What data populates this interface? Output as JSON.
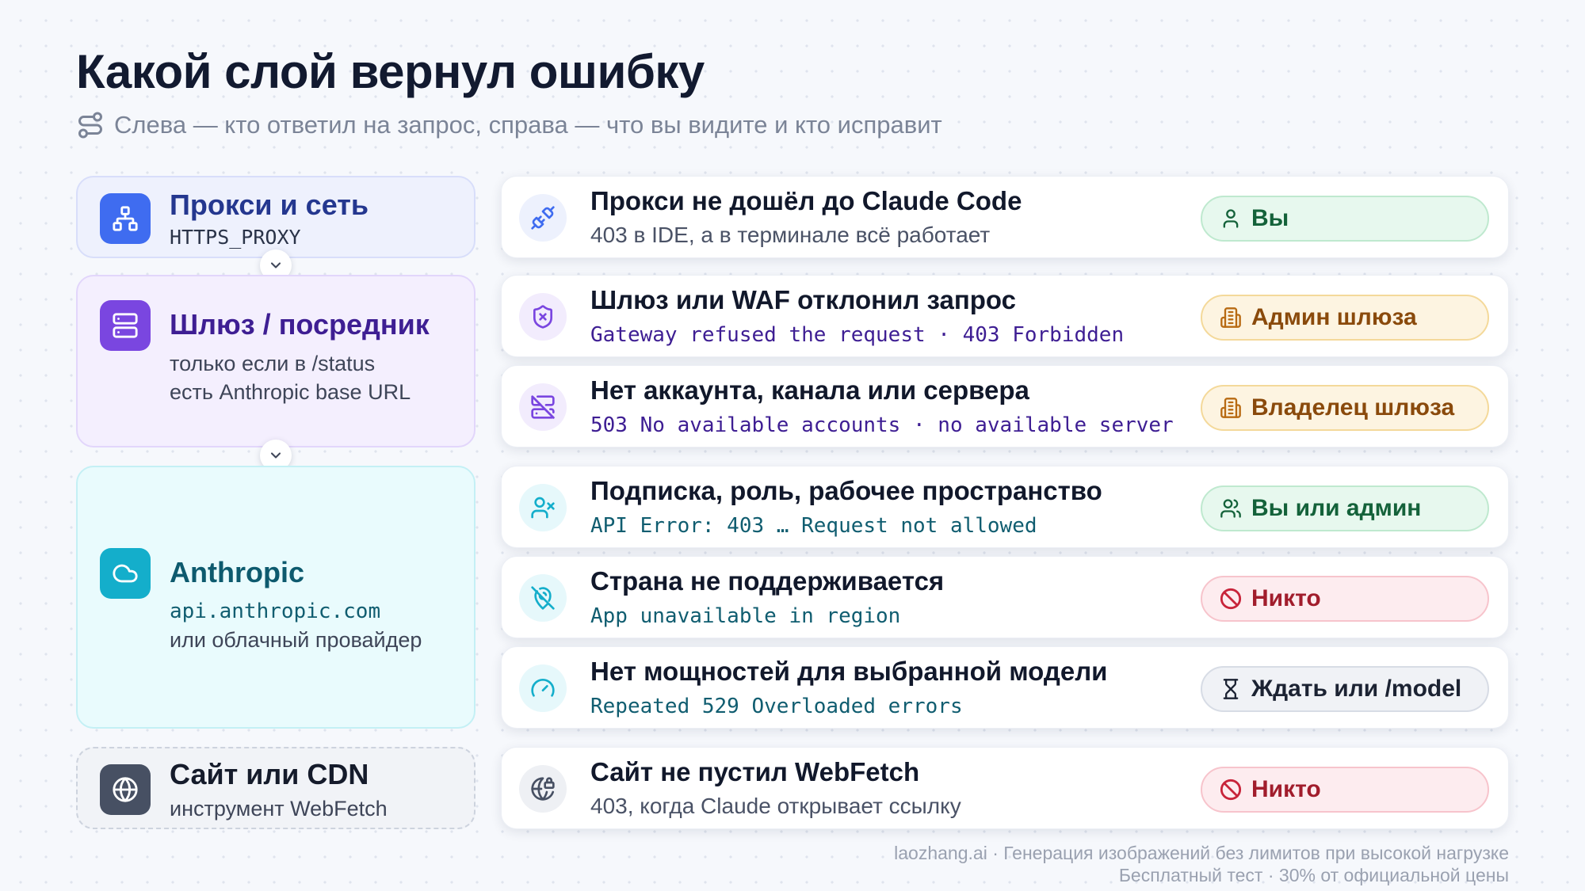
{
  "header": {
    "title": "Какой слой вернул ошибку",
    "subtitle": "Слева — кто ответил на запрос, справа — что вы видите и кто исправит",
    "subtitle_icon": "route-icon"
  },
  "layers": [
    {
      "name": "Прокси и сеть",
      "detail": "HTTPS_PROXY",
      "icon": "network-icon",
      "color": "#3f6cf0"
    },
    {
      "name": "Шлюз / посредник",
      "detail_line1": "только если в /status",
      "detail_line2": "есть Anthropic base URL",
      "icon": "server-icon",
      "color": "#7a46e0"
    },
    {
      "name": "Anthropic",
      "detail_mono": "api.anthropic.com",
      "detail_line2": "или облачный провайдер",
      "icon": "cloud-icon",
      "color": "#14aecb"
    },
    {
      "name": "Сайт или CDN",
      "detail": "инструмент WebFetch",
      "icon": "globe-icon",
      "color": "#475063"
    }
  ],
  "errors": [
    {
      "title": "Прокси не дошёл до Claude Code",
      "detail": "403 в IDE, а в терминале всё работает",
      "owner": "Вы",
      "icon": "unplug-icon",
      "owner_icon": "user-icon"
    },
    {
      "title": "Шлюз или WAF отклонил запрос",
      "detail": "Gateway refused the request · 403 Forbidden",
      "owner": "Админ шлюза",
      "icon": "shield-x-icon",
      "owner_icon": "building-icon"
    },
    {
      "title": "Нет аккаунта, канала или сервера",
      "detail": "503 No available accounts · no available server",
      "owner": "Владелец шлюза",
      "icon": "server-off-icon",
      "owner_icon": "building-icon"
    },
    {
      "title": "Подписка, роль, рабочее пространство",
      "detail": "API Error: 403 … Request not allowed",
      "owner": "Вы или админ",
      "icon": "user-x-icon",
      "owner_icon": "users-icon"
    },
    {
      "title": "Страна не поддерживается",
      "detail": "App unavailable in region",
      "owner": "Никто",
      "icon": "map-pin-off-icon",
      "owner_icon": "ban-icon"
    },
    {
      "title": "Нет мощностей для выбранной модели",
      "detail": "Repeated 529 Overloaded errors",
      "owner": "Ждать или /model",
      "icon": "gauge-icon",
      "owner_icon": "hourglass-icon"
    },
    {
      "title": "Сайт не пустил WebFetch",
      "detail": "403, когда Claude открывает ссылку",
      "owner": "Никто",
      "icon": "globe-lock-icon",
      "owner_icon": "ban-icon"
    }
  ],
  "footer": {
    "line1": "laozhang.ai · Генерация изображений без лимитов при высокой нагрузке",
    "line2": "Бесплатный тест · 30% от официальной цены"
  }
}
